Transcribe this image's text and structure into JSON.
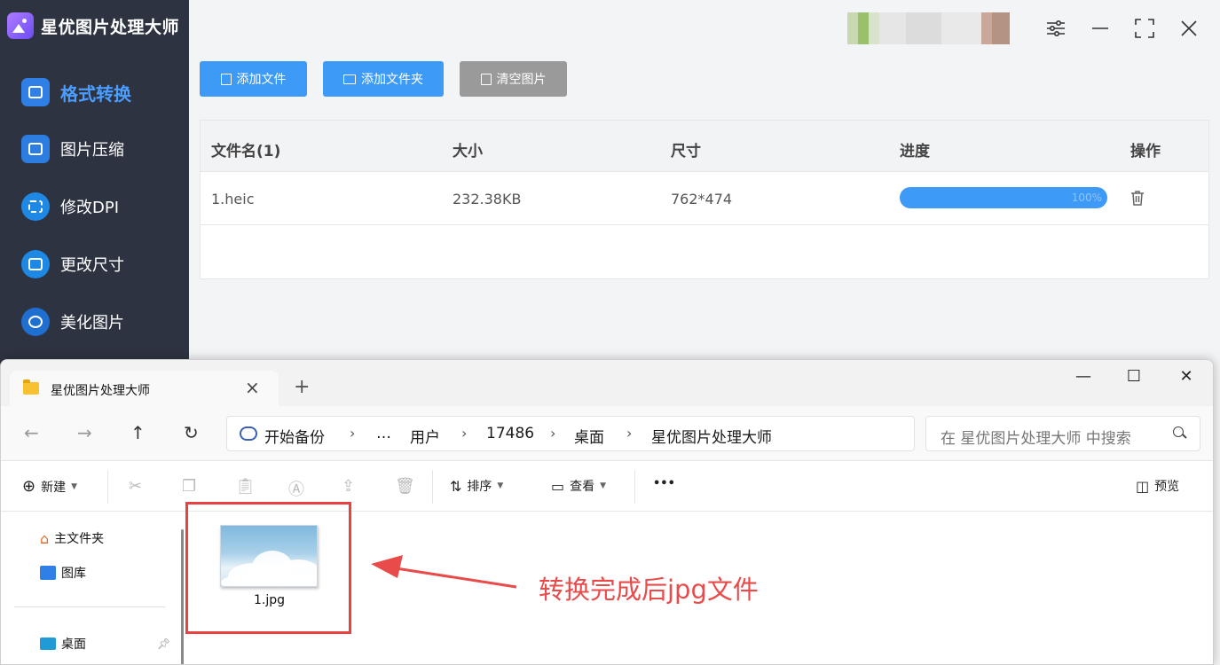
{
  "app": {
    "title": "星优图片处理大师",
    "nav": [
      {
        "label": "格式转换",
        "icon": "image-convert-icon",
        "active": true
      },
      {
        "label": "图片压缩",
        "icon": "image-compress-icon",
        "active": false
      },
      {
        "label": "修改DPI",
        "icon": "dpi-icon",
        "active": false
      },
      {
        "label": "更改尺寸",
        "icon": "resize-icon",
        "active": false
      },
      {
        "label": "美化图片",
        "icon": "beautify-icon",
        "active": false
      }
    ],
    "toolbar": {
      "add_file": "添加文件",
      "add_folder": "添加文件夹",
      "clear": "清空图片"
    },
    "table": {
      "headers": [
        "文件名(1)",
        "大小",
        "尺寸",
        "进度",
        "操作"
      ],
      "rows": [
        {
          "name": "1.heic",
          "size": "232.38KB",
          "dimensions": "762*474",
          "progress": 1.0,
          "progress_label": "100%"
        }
      ]
    },
    "colors": {
      "accent": "#3d9bf7",
      "sidebar": "#2e3341",
      "active_nav": "#4a9eff"
    }
  },
  "explorer": {
    "tab_title": "星优图片处理大师",
    "breadcrumb": [
      "开始备份",
      "…",
      "用户",
      "17486",
      "桌面",
      "星优图片处理大师"
    ],
    "search_placeholder": "在 星优图片处理大师 中搜索",
    "commands": {
      "new": "新建",
      "sort": "排序",
      "view": "查看",
      "more": "•••",
      "preview": "预览"
    },
    "sidebar": [
      "主文件夹",
      "图库",
      "桌面"
    ],
    "file": {
      "name": "1.jpg"
    }
  },
  "annotation": {
    "text": "转换完成后jpg文件",
    "color": "#e94b4b"
  }
}
